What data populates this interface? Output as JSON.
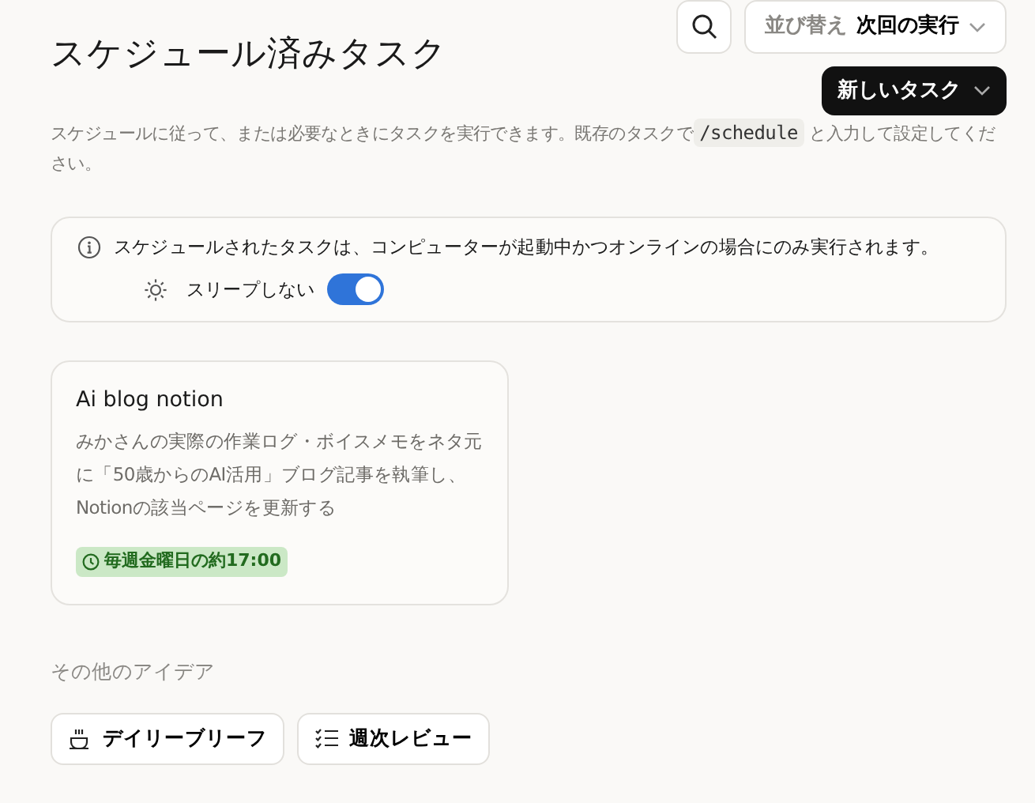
{
  "header": {
    "title": "スケジュール済みタスク",
    "sort": {
      "label": "並び替え",
      "value": "次回の実行"
    },
    "new_task": "新しいタスク"
  },
  "description": {
    "before": "スケジュールに従って、または必要なときにタスクを実行できます。既存のタスクで",
    "code": "/schedule",
    "after": "と入力して設定してください。"
  },
  "notice": {
    "text": "スケジュールされたタスクは、コンピューターが起動中かつオンラインの場合にのみ実行されます。",
    "setting": {
      "label": "スリープしない",
      "on": true
    }
  },
  "tasks": [
    {
      "title": "Ai blog notion",
      "description": "みかさんの実際の作業ログ・ボイスメモをネタ元に「50歳からのAI活用」ブログ記事を執筆し、Notionの該当ページを更新する",
      "schedule": "毎週金曜日の約17:00"
    }
  ],
  "ideas": {
    "heading": "その他のアイデア",
    "items": [
      {
        "kind": "cup",
        "label": "デイリーブリーフ"
      },
      {
        "kind": "list",
        "label": "週次レビュー"
      }
    ]
  }
}
